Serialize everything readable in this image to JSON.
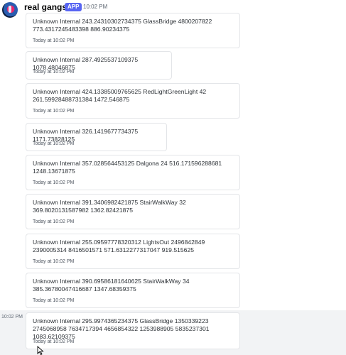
{
  "header": {
    "username": "real gangster",
    "badge": "APP",
    "time": "10:02 PM"
  },
  "hover_row": {
    "time": "10:02 PM"
  },
  "messages": [
    {
      "text": "Unknown Internal 243.24310302734375 GlassBridge 4800207822 773.4317245483398 886.90234375",
      "time": "Today at 10:02 PM"
    },
    {
      "text": "Unknown Internal 287.4925537109375 1078.48046875",
      "time": "Today at 10:02 PM"
    },
    {
      "text": "Unknown Internal 424.13385009765625 RedLightGreenLight 42 261.59928488731384 1472.546875",
      "time": "Today at 10:02 PM"
    },
    {
      "text": "Unknown Internal 326.1419677734375 1171.73828125",
      "time": "Today at 10:02 PM"
    },
    {
      "text": "Unknown Internal 357.028564453125 Dalgona 24 516.171596288681 1248.13671875",
      "time": "Today at 10:02 PM"
    },
    {
      "text": "Unknown Internal 391.3406982421875 StairWalkWay 32 369.8020131587982 1362.82421875",
      "time": "Today at 10:02 PM"
    },
    {
      "text": "Unknown Internal 255.09597778320312 LightsOut 2496842849 2390005314 8416501571 571.6312277317047 919.515625",
      "time": "Today at 10:02 PM"
    },
    {
      "text": "Unknown Internal 390.69586181640625 StairWalkWay 34 385.36780047416687 1347.68359375",
      "time": "Today at 10:02 PM"
    },
    {
      "text": "Unknown Internal 295.9974365234375 GlassBridge 1350339223 2745068958 7634717394 4656854322 1253988905 5835237301 1083.62109375",
      "time": "Today at 10:02 PM"
    }
  ]
}
